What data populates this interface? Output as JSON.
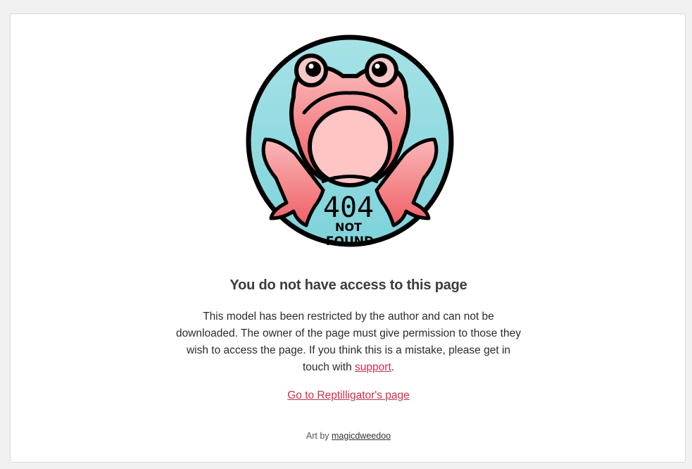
{
  "page": {
    "title": "You do not have access to this page",
    "message_text": "This model has been restricted by the author and can not be downloaded. The owner of the page must give permission to those they wish to access the page. If you think this is a mistake, please get in touch with ",
    "support_link": "support",
    "message_end": ".",
    "go_link": "Go to Reptilligator's page",
    "credit_prefix": "Art by ",
    "credit_name": "magicdweedoo"
  },
  "illustration": {
    "icon": "frog-404-icon",
    "text_404": "404",
    "text_not": "NOT",
    "text_found": "FOUND",
    "colors": {
      "background": "#8fdbe0",
      "frog_body": "#f47a7e",
      "frog_belly": "#ffc4c4",
      "outline": "#000000"
    }
  },
  "colors": {
    "link": "#c8304a",
    "title": "#3c3c3c"
  }
}
